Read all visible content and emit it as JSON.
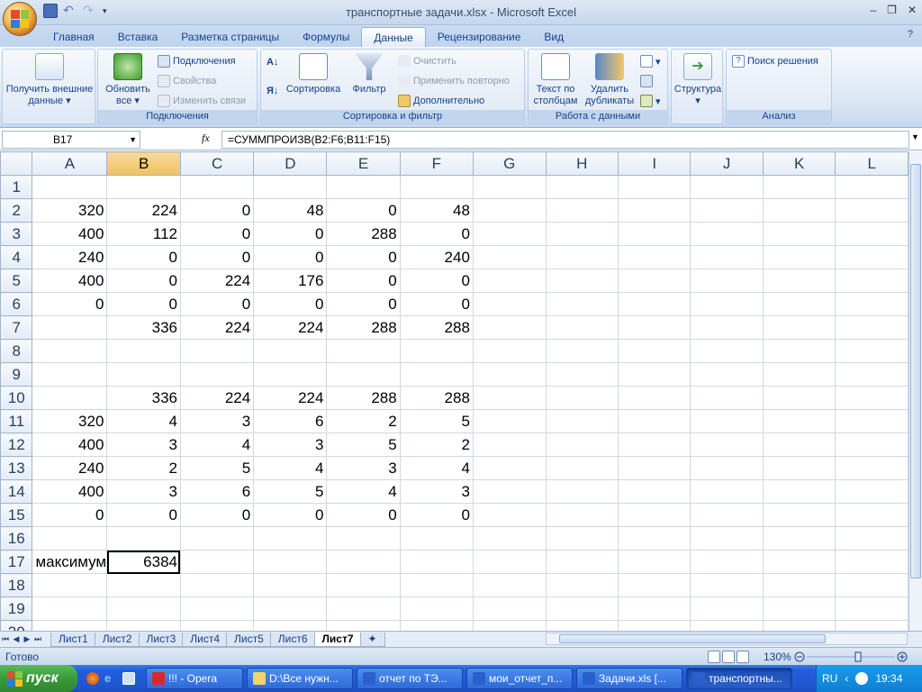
{
  "window": {
    "title": "транспортные задачи.xlsx - Microsoft Excel",
    "minimize_icon": "minimize-icon",
    "restore_icon": "restore-icon",
    "close_icon": "close-icon"
  },
  "ribbon_tabs": [
    "Главная",
    "Вставка",
    "Разметка страницы",
    "Формулы",
    "Данные",
    "Рецензирование",
    "Вид"
  ],
  "active_tab": "Данные",
  "ribbon": {
    "get_external": "Получить внешние данные",
    "refresh_all": "Обновить все",
    "connections": "Подключения",
    "properties": "Свойства",
    "edit_links": "Изменить связи",
    "connections_group": "Подключения",
    "sort_label": "Сортировка",
    "filter_label": "Фильтр",
    "clear": "Очистить",
    "reapply": "Применить повторно",
    "advanced": "Дополнительно",
    "sort_filter_group": "Сортировка и фильтр",
    "text_to_columns": "Текст по столбцам",
    "remove_duplicates": "Удалить дубликаты",
    "data_tools_group": "Работа с данными",
    "outline": "Структура",
    "solver": "Поиск решения",
    "analysis_group": "Анализ"
  },
  "formula_bar": {
    "name_box": "B17",
    "fx": "fx",
    "formula": "=СУММПРОИЗВ(B2:F6;B11:F15)"
  },
  "columns": [
    "A",
    "B",
    "C",
    "D",
    "E",
    "F",
    "G",
    "H",
    "I",
    "J",
    "K",
    "L"
  ],
  "selected_column": "B",
  "rows": [
    {
      "n": "1",
      "cells": [
        "",
        "",
        "",
        "",
        "",
        ""
      ]
    },
    {
      "n": "2",
      "cells": [
        "320",
        "224",
        "0",
        "48",
        "0",
        "48"
      ]
    },
    {
      "n": "3",
      "cells": [
        "400",
        "112",
        "0",
        "0",
        "288",
        "0"
      ]
    },
    {
      "n": "4",
      "cells": [
        "240",
        "0",
        "0",
        "0",
        "0",
        "240"
      ]
    },
    {
      "n": "5",
      "cells": [
        "400",
        "0",
        "224",
        "176",
        "0",
        "0"
      ]
    },
    {
      "n": "6",
      "cells": [
        "0",
        "0",
        "0",
        "0",
        "0",
        "0"
      ]
    },
    {
      "n": "7",
      "cells": [
        "",
        "336",
        "224",
        "224",
        "288",
        "288"
      ]
    },
    {
      "n": "8",
      "cells": [
        "",
        "",
        "",
        "",
        "",
        ""
      ]
    },
    {
      "n": "9",
      "cells": [
        "",
        "",
        "",
        "",
        "",
        ""
      ]
    },
    {
      "n": "10",
      "cells": [
        "",
        "336",
        "224",
        "224",
        "288",
        "288"
      ]
    },
    {
      "n": "11",
      "cells": [
        "320",
        "4",
        "3",
        "6",
        "2",
        "5"
      ]
    },
    {
      "n": "12",
      "cells": [
        "400",
        "3",
        "4",
        "3",
        "5",
        "2"
      ]
    },
    {
      "n": "13",
      "cells": [
        "240",
        "2",
        "5",
        "4",
        "3",
        "4"
      ]
    },
    {
      "n": "14",
      "cells": [
        "400",
        "3",
        "6",
        "5",
        "4",
        "3"
      ]
    },
    {
      "n": "15",
      "cells": [
        "0",
        "0",
        "0",
        "0",
        "0",
        "0"
      ]
    },
    {
      "n": "16",
      "cells": [
        "",
        "",
        "",
        "",
        "",
        ""
      ]
    },
    {
      "n": "17",
      "cells": [
        "максимум",
        "6384",
        "",
        "",
        "",
        ""
      ]
    },
    {
      "n": "18",
      "cells": [
        "",
        "",
        "",
        "",
        "",
        ""
      ]
    },
    {
      "n": "19",
      "cells": [
        "",
        "",
        "",
        "",
        "",
        ""
      ]
    },
    {
      "n": "20",
      "cells": [
        "",
        "",
        "",
        "",
        "",
        ""
      ]
    }
  ],
  "sheets": [
    "Лист1",
    "Лист2",
    "Лист3",
    "Лист4",
    "Лист5",
    "Лист6",
    "Лист7"
  ],
  "active_sheet": "Лист7",
  "status": {
    "text": "Готово",
    "zoom": "130%"
  },
  "taskbar": {
    "start": "пуск",
    "items": [
      "!!! - Opera",
      "D:\\Все нужн...",
      "отчет по ТЭ...",
      "мои_отчет_п...",
      "Задачи.xls [...",
      "транспортны..."
    ],
    "active_item": "транспортны...",
    "lang": "RU",
    "clock": "19:34"
  },
  "colors": {
    "accent": "#15428b",
    "selected_header": "#f1c15f",
    "taskbar": "#245edb",
    "start": "#3a9a3a"
  }
}
